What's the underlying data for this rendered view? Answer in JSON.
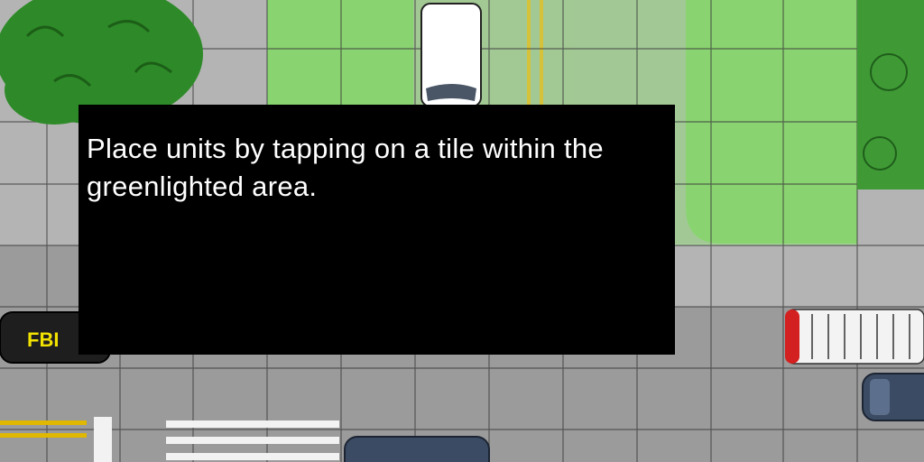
{
  "game": {
    "tutorial_message": "Place units by tapping on a tile within the greenlighted area.",
    "vehicles": {
      "fbi_car_label": "FBI"
    }
  },
  "colors": {
    "road_asphalt": "#9b9b9b",
    "sidewalk": "#b4b4b4",
    "grass": "#64b44a",
    "green_highlight": "#8fd877",
    "tree": "#2e8a28",
    "dialog_bg": "#000000",
    "dialog_text": "#ffffff",
    "lane_line_yellow": "#e0b800",
    "fbi_text": "#f2e200"
  }
}
